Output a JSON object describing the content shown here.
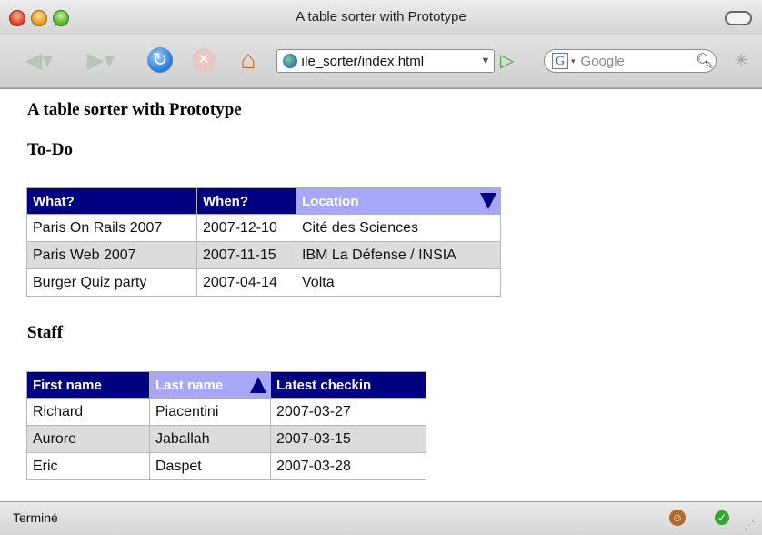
{
  "window": {
    "title": "A table sorter with Prototype"
  },
  "toolbar": {
    "url": "ıle_sorter/index.html",
    "search_placeholder": "Google"
  },
  "page": {
    "title": "A table sorter with Prototype",
    "todo": {
      "heading": "To-Do",
      "headers": [
        "What?",
        "When?",
        "Location"
      ],
      "sorted_column": "Location",
      "sort_direction": "descending",
      "rows": [
        [
          "Paris On Rails 2007",
          "2007-12-10",
          "Cité des Sciences"
        ],
        [
          "Paris Web 2007",
          "2007-11-15",
          "IBM La Défense / INSIA"
        ],
        [
          "Burger Quiz party",
          "2007-04-14",
          "Volta"
        ]
      ]
    },
    "staff": {
      "heading": "Staff",
      "headers": [
        "First name",
        "Last name",
        "Latest checkin"
      ],
      "sorted_column": "Last name",
      "sort_direction": "ascending",
      "rows": [
        [
          "Richard",
          "Piacentini",
          "2007-03-27"
        ],
        [
          "Aurore",
          "Jaballah",
          "2007-03-15"
        ],
        [
          "Eric",
          "Daspet",
          "2007-03-28"
        ]
      ]
    }
  },
  "status": {
    "text": "Terminé"
  },
  "colors": {
    "header_bg": "#000080",
    "sorted_header_bg": "#a7a7f7",
    "alt_row_bg": "#dcdcdc"
  }
}
